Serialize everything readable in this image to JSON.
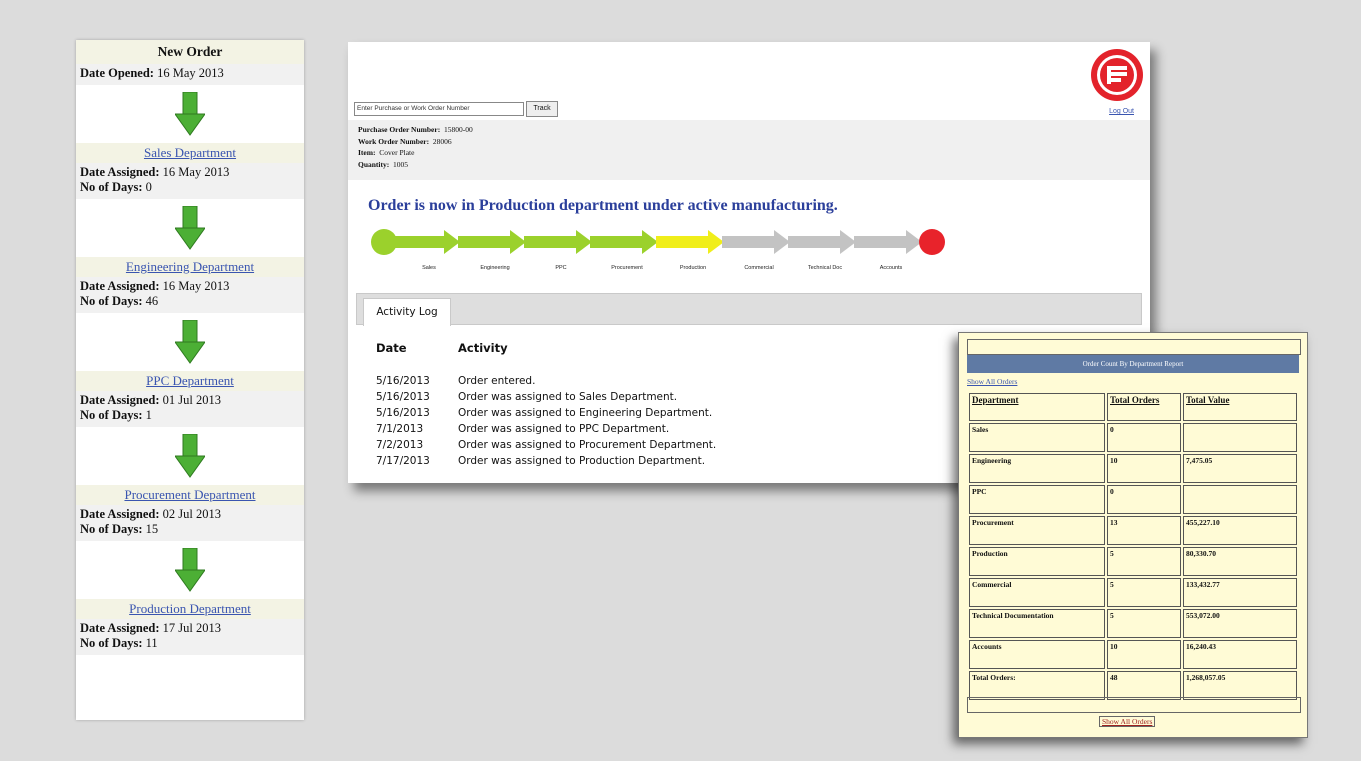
{
  "workflow": {
    "title": "New Order",
    "opened_label": "Date Opened:",
    "opened_value": "16 May 2013",
    "assigned_label": "Date Assigned:",
    "days_label": "No of Days:",
    "departments": [
      {
        "name": "Sales Department",
        "assigned": "16 May 2013",
        "days": "0"
      },
      {
        "name": "Engineering Department",
        "assigned": "16 May 2013",
        "days": "46"
      },
      {
        "name": "PPC Department",
        "assigned": "01 Jul 2013",
        "days": "1"
      },
      {
        "name": "Procurement Department",
        "assigned": "02 Jul 2013",
        "days": "15"
      },
      {
        "name": "Production Department",
        "assigned": "17 Jul 2013",
        "days": "11"
      }
    ],
    "arrow_color": "#4caf35"
  },
  "main": {
    "search_placeholder": "Enter Purchase or Work Order Number",
    "track_button": "Track",
    "logout_link": "Log Out",
    "details": [
      {
        "label": "Purchase Order Number:",
        "value": "15800-00"
      },
      {
        "label": "Work Order Number:",
        "value": "28006"
      },
      {
        "label": "Item:",
        "value": "Cover Plate"
      },
      {
        "label": "Quantity:",
        "value": "1005"
      }
    ],
    "status_message": "Order is now in Production department under active manufacturing.",
    "progress_steps": [
      {
        "label": "Sales",
        "state": "done"
      },
      {
        "label": "Engineering",
        "state": "done"
      },
      {
        "label": "PPC",
        "state": "done"
      },
      {
        "label": "Procurement",
        "state": "done"
      },
      {
        "label": "Production",
        "state": "current"
      },
      {
        "label": "Commercial",
        "state": "pending"
      },
      {
        "label": "Technical Doc",
        "state": "pending"
      },
      {
        "label": "Accounts",
        "state": "pending"
      }
    ],
    "colors": {
      "done": "#9bd12c",
      "current": "#f0ee1a",
      "pending": "#c3c3c3",
      "end": "#e8232b",
      "status_text": "#2b3f9b"
    },
    "activity_tab": "Activity Log",
    "log_headers": {
      "date": "Date",
      "activity": "Activity"
    },
    "log_rows": [
      {
        "date": "5/16/2013",
        "activity": "Order entered."
      },
      {
        "date": "5/16/2013",
        "activity": "Order was assigned to Sales Department."
      },
      {
        "date": "5/16/2013",
        "activity": "Order was assigned to Engineering Department."
      },
      {
        "date": "7/1/2013",
        "activity": "Order was assigned to PPC Department."
      },
      {
        "date": "7/2/2013",
        "activity": "Order was assigned to Procurement Department."
      },
      {
        "date": "7/17/2013",
        "activity": "Order was assigned to Production Department."
      }
    ]
  },
  "report": {
    "title": "Order Count By Department Report",
    "show_all_top": "Show All Orders",
    "headers": [
      "Department",
      "Total Orders",
      "Total Value"
    ],
    "rows": [
      {
        "dept": "Sales",
        "orders": "0",
        "value": ""
      },
      {
        "dept": "Engineering",
        "orders": "10",
        "value": "7,475.05"
      },
      {
        "dept": "PPC",
        "orders": "0",
        "value": ""
      },
      {
        "dept": "Procurement",
        "orders": "13",
        "value": "455,227.10"
      },
      {
        "dept": "Production",
        "orders": "5",
        "value": "80,330.70"
      },
      {
        "dept": "Commercial",
        "orders": "5",
        "value": "133,432.77"
      },
      {
        "dept": "Technical Documentation",
        "orders": "5",
        "value": "553,072.00"
      },
      {
        "dept": "Accounts",
        "orders": "10",
        "value": "16,240.43"
      },
      {
        "dept": "Total Orders:",
        "orders": "48",
        "value": "1,268,057.05"
      }
    ],
    "show_all_bottom": "Show All Orders",
    "header_color": "#5f7aa4",
    "background_color": "#fffbd6"
  }
}
